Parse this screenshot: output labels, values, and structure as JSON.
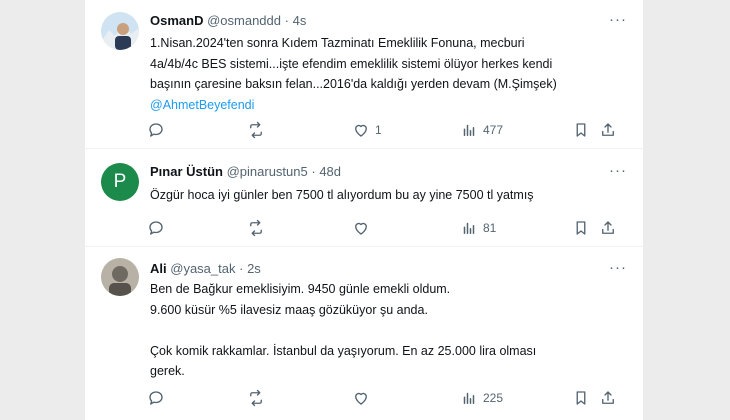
{
  "tweets": [
    {
      "name": "OsmanD",
      "handle": "@osmanddd",
      "separator": "·",
      "time": "4s",
      "lines": [
        "1.Nisan.2024'ten sonra Kıdem Tazminatı Emeklilik Fonuna, mecburi",
        "4a/4b/4c BES sistemi...işte efendim emeklilik sistemi ölüyor herkes kendi",
        "başının çaresine baksın felan...2016'da kaldığı yerden devam (M.Şimşek)"
      ],
      "mention": "@AhmetBeyefendi",
      "likes": "1",
      "views": "477"
    },
    {
      "name": "Pınar Üstün",
      "handle": "@pinarustun5",
      "separator": "·",
      "time": "48d",
      "avatar_letter": "P",
      "lines": [
        "Özgür hoca  iyi günler ben 7500 tl alıyordum bu ay yine 7500 tl yatmış"
      ],
      "views": "81"
    },
    {
      "name": "Ali",
      "handle": "@yasa_tak",
      "separator": "·",
      "time": "2s",
      "lines": [
        "Ben de Bağkur emeklisiyim. 9450 günle emekli oldum.",
        "9.600 küsür %5 ilavesiz maaş gözüküyor şu anda.",
        "",
        "Çok komik rakkamlar. İstanbul da yaşıyorum. En az 25.000 lira olması",
        "gerek."
      ],
      "views": "225"
    }
  ],
  "colors": {
    "accent": "#1d9bf0",
    "text": "#0f1419",
    "secondary": "#536471",
    "avatar_green": "#1b8a4a"
  },
  "icons": [
    "more-icon",
    "reply-icon",
    "retweet-icon",
    "like-icon",
    "views-icon",
    "bookmark-icon",
    "share-icon"
  ]
}
